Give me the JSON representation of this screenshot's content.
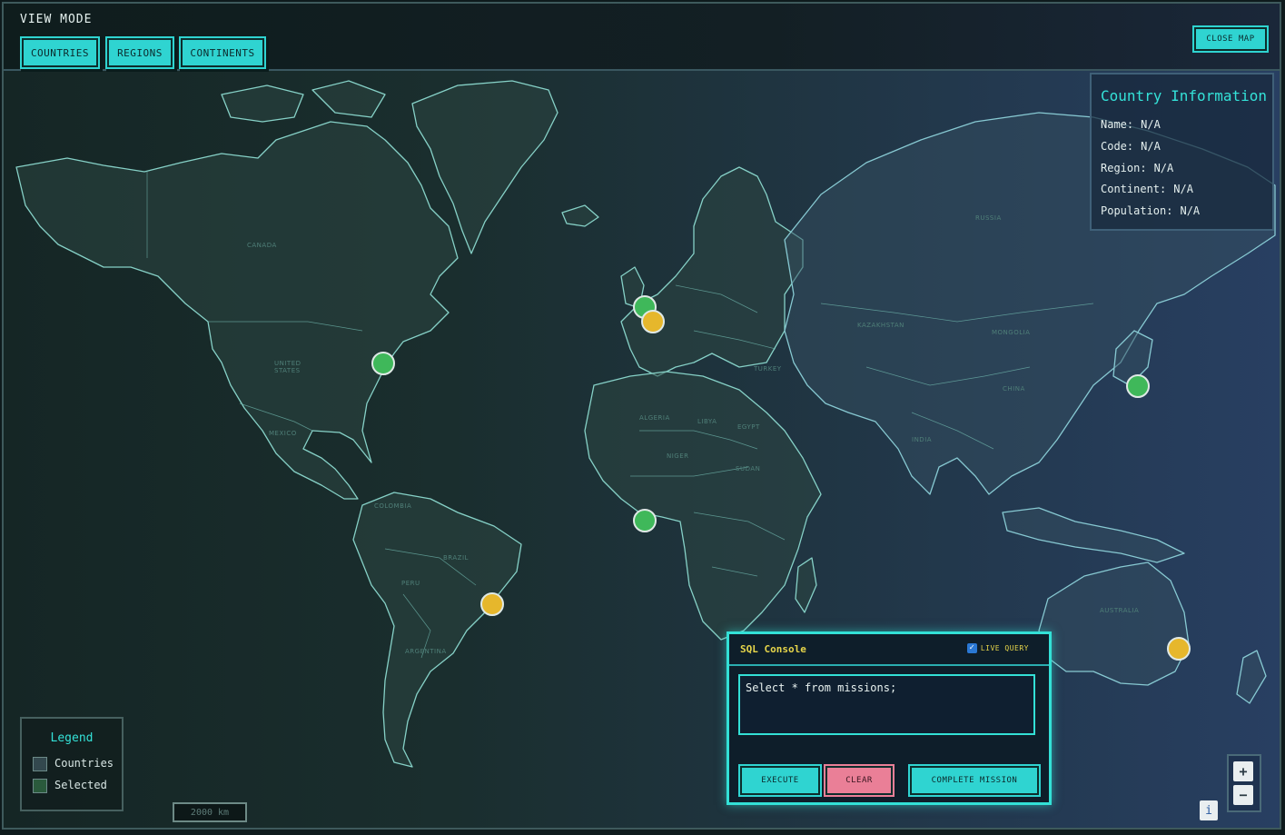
{
  "header": {
    "view_mode_label": "VIEW MODE",
    "modes": [
      {
        "label": "COUNTRIES"
      },
      {
        "label": "REGIONS"
      },
      {
        "label": "CONTINENTS"
      }
    ],
    "close_label": "CLOSE MAP"
  },
  "info": {
    "title": "Country Information",
    "rows": [
      {
        "key": "Name:",
        "value": "N/A"
      },
      {
        "key": "Code:",
        "value": "N/A"
      },
      {
        "key": "Region:",
        "value": "N/A"
      },
      {
        "key": "Continent:",
        "value": "N/A"
      },
      {
        "key": "Population:",
        "value": "N/A"
      }
    ]
  },
  "legend": {
    "title": "Legend",
    "items": [
      {
        "label": "Countries",
        "color": "#33484e"
      },
      {
        "label": "Selected",
        "color": "#2a5a3c"
      }
    ]
  },
  "scale": {
    "label": "2000 km"
  },
  "map": {
    "labels": [
      "CANADA",
      "UNITED STATES",
      "BRAZIL",
      "RUSSIA",
      "CHINA",
      "INDIA",
      "KAZAKHSTAN",
      "MONGOLIA",
      "AUSTRALIA",
      "ALGERIA",
      "LIBYA",
      "EGYPT",
      "NIGER",
      "SUDAN",
      "TURKEY",
      "COLOMBIA",
      "PERU",
      "ARGENTINA",
      "MEXICO"
    ],
    "markers": [
      {
        "name": "marker-north-america",
        "status": "green",
        "color": "#3fb85a"
      },
      {
        "name": "marker-uk",
        "status": "green",
        "color": "#3fb85a"
      },
      {
        "name": "marker-france",
        "status": "yellow",
        "color": "#e6b72c"
      },
      {
        "name": "marker-west-africa",
        "status": "green",
        "color": "#3fb85a"
      },
      {
        "name": "marker-brazil",
        "status": "yellow",
        "color": "#e6b72c"
      },
      {
        "name": "marker-japan",
        "status": "green",
        "color": "#3fb85a"
      },
      {
        "name": "marker-australia",
        "status": "yellow",
        "color": "#e6b72c"
      }
    ]
  },
  "sql": {
    "title": "SQL Console",
    "live_label": "LIVE QUERY",
    "live_checked": true,
    "query": "Select * from missions;",
    "execute_label": "EXECUTE",
    "clear_label": "CLEAR",
    "complete_label": "COMPLETE MISSION"
  },
  "zoom": {
    "in_label": "+",
    "out_label": "−"
  },
  "info_button": {
    "label": "i"
  },
  "colors": {
    "accent": "#2fd4d1",
    "clear": "#ea7f97",
    "sql_title": "#e6d54a",
    "info_title": "#34e2d8"
  }
}
